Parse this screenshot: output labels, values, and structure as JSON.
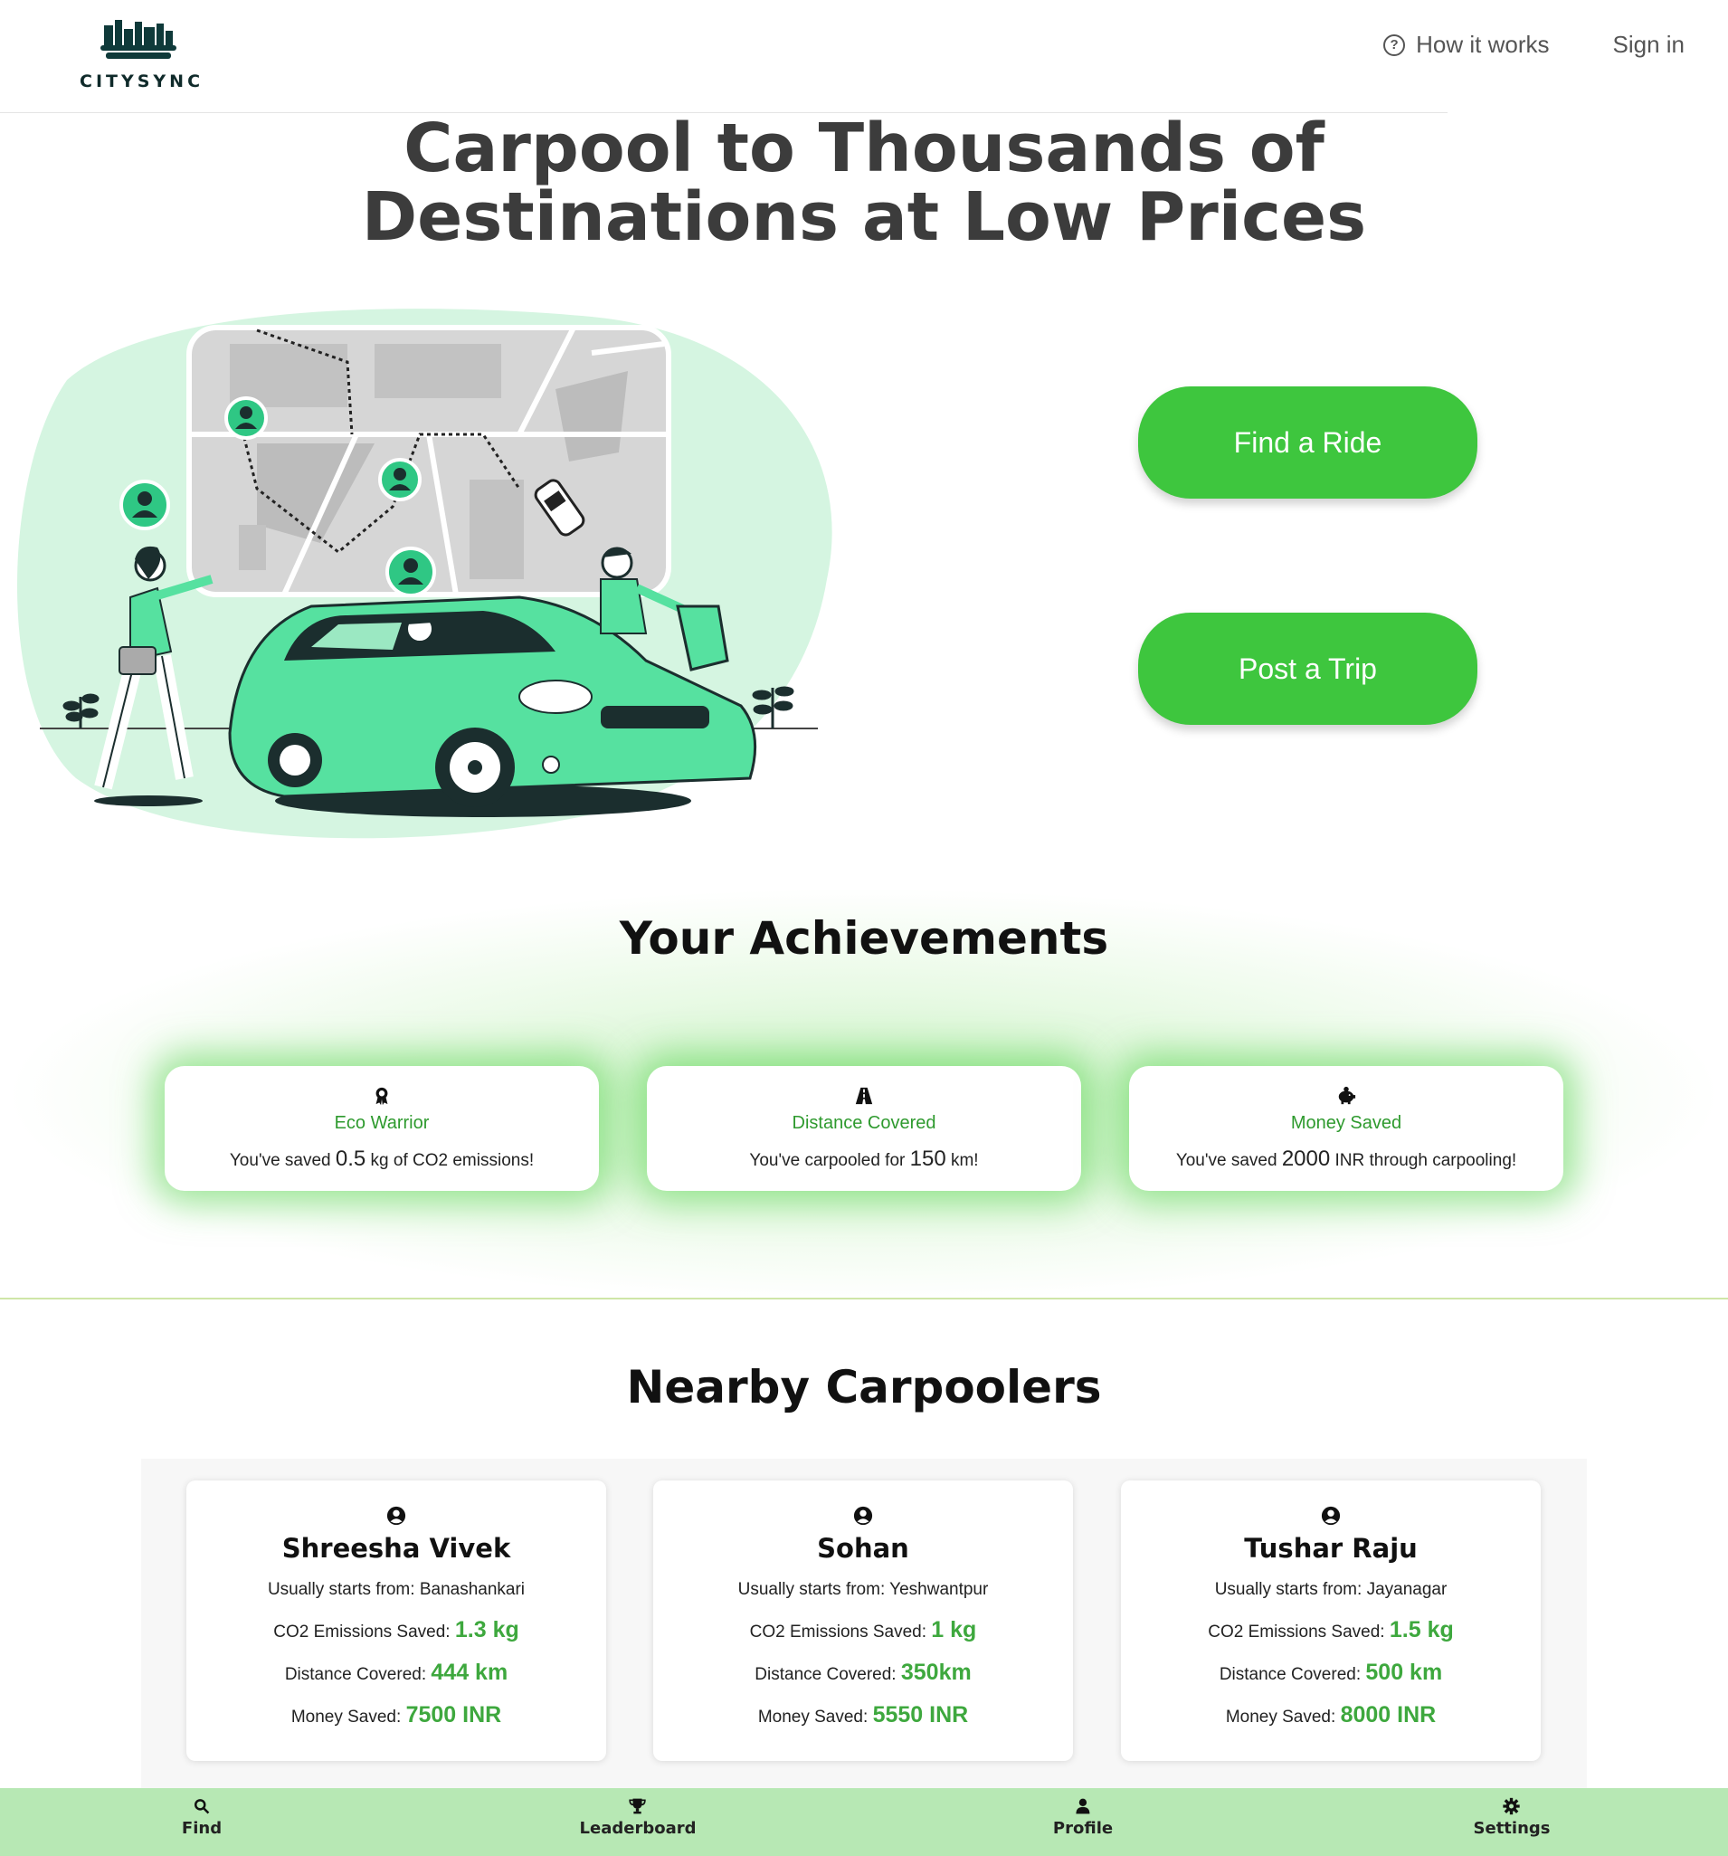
{
  "header": {
    "logo_text": "CITYSYNC",
    "nav": {
      "how_it_works": "How it works",
      "sign_in": "Sign in"
    }
  },
  "hero": {
    "title_line1": "Carpool to Thousands of",
    "title_line2": "Destinations at Low Prices",
    "find_ride": "Find a Ride",
    "post_trip": "Post a Trip"
  },
  "achievements": {
    "title": "Your Achievements",
    "cards": [
      {
        "icon": "award-icon",
        "title": "Eco Warrior",
        "prefix": "You've saved ",
        "value": "0.5",
        "suffix": " kg of CO2 emissions!"
      },
      {
        "icon": "road-icon",
        "title": "Distance Covered",
        "prefix": "You've carpooled for ",
        "value": "150",
        "suffix": " km!"
      },
      {
        "icon": "piggy-bank-icon",
        "title": "Money Saved",
        "prefix": "You've saved ",
        "value": "2000",
        "suffix": " INR through carpooling!"
      }
    ]
  },
  "carpoolers": {
    "title": "Nearby Carpoolers",
    "labels": {
      "starts": "Usually starts from: ",
      "co2": "CO2 Emissions Saved: ",
      "distance": "Distance Covered: ",
      "money": "Money Saved: "
    },
    "items": [
      {
        "name": "Shreesha Vivek",
        "starts": "Banashankari",
        "co2": "1.3 kg",
        "distance": "444 km",
        "money": "7500 INR"
      },
      {
        "name": "Sohan",
        "starts": "Yeshwantpur",
        "co2": "1 kg",
        "distance": "350km",
        "money": "5550 INR"
      },
      {
        "name": "Tushar Raju",
        "starts": "Jayanagar",
        "co2": "1.5 kg",
        "distance": "500 km",
        "money": "8000 INR"
      }
    ]
  },
  "bottom_nav": {
    "find": "Find",
    "leaderboard": "Leaderboard",
    "profile": "Profile",
    "settings": "Settings"
  },
  "colors": {
    "accent": "#3ec63e",
    "accent_text": "#3ea83e",
    "bottom_nav_bg": "#b7e8b4",
    "illustration_bg": "#d5f5e1",
    "car": "#56e1a0"
  }
}
